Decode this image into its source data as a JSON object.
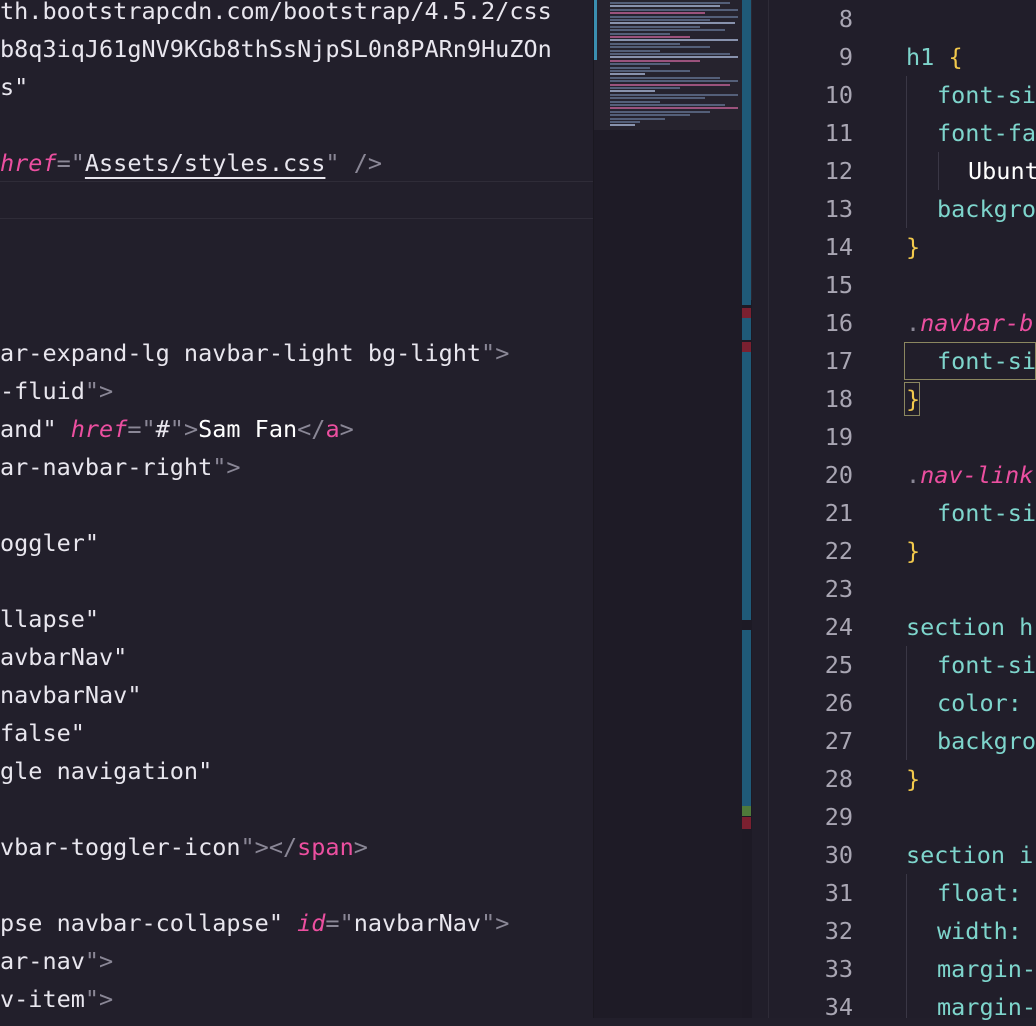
{
  "left_editor": {
    "lines": [
      {
        "parts": [
          [
            "tok-str",
            "th.bootstrapcdn.com/bootstrap/4.5.2/css"
          ]
        ]
      },
      {
        "parts": [
          [
            "tok-str",
            "b8q3iqJ61gNV9KGb8thSsNjpSL0n8PARn9HuZOn"
          ]
        ]
      },
      {
        "parts": [
          [
            "tok-str",
            "s\""
          ]
        ]
      },
      {
        "parts": []
      },
      {
        "parts": [
          [
            "tok-attr",
            "href"
          ],
          [
            "tok-punc",
            "=\""
          ],
          [
            "tok-str underline",
            "Assets/styles.css"
          ],
          [
            "tok-punc",
            "\" />"
          ]
        ]
      },
      {
        "parts": []
      },
      {
        "parts": []
      },
      {
        "parts": []
      },
      {
        "parts": []
      },
      {
        "parts": [
          [
            "tok-str",
            "ar-expand-lg navbar-light bg-light"
          ],
          [
            "tok-punc",
            "\">"
          ]
        ]
      },
      {
        "parts": [
          [
            "tok-str",
            "-fluid"
          ],
          [
            "tok-punc",
            "\">"
          ]
        ]
      },
      {
        "parts": [
          [
            "tok-str",
            "and\" "
          ],
          [
            "tok-attr",
            "href"
          ],
          [
            "tok-punc",
            "=\""
          ],
          [
            "tok-str",
            "#"
          ],
          [
            "tok-punc",
            "\">"
          ],
          [
            "tok-text",
            "Sam Fan"
          ],
          [
            "tok-punc",
            "</"
          ],
          [
            "tok-tag",
            "a"
          ],
          [
            "tok-punc",
            ">"
          ]
        ]
      },
      {
        "parts": [
          [
            "tok-str",
            "ar-navbar-right"
          ],
          [
            "tok-punc",
            "\">"
          ]
        ]
      },
      {
        "parts": []
      },
      {
        "parts": [
          [
            "tok-str",
            "oggler\""
          ]
        ]
      },
      {
        "parts": []
      },
      {
        "parts": [
          [
            "tok-str",
            "llapse\""
          ]
        ]
      },
      {
        "parts": [
          [
            "tok-str",
            "avbarNav\""
          ]
        ]
      },
      {
        "parts": [
          [
            "tok-str",
            "navbarNav\""
          ]
        ]
      },
      {
        "parts": [
          [
            "tok-str",
            "false\""
          ]
        ]
      },
      {
        "parts": [
          [
            "tok-str",
            "gle navigation\""
          ]
        ]
      },
      {
        "parts": []
      },
      {
        "parts": [
          [
            "tok-str",
            "vbar-toggler-icon"
          ],
          [
            "tok-punc",
            "\"></"
          ],
          [
            "tok-tag",
            "span"
          ],
          [
            "tok-punc",
            ">"
          ]
        ]
      },
      {
        "parts": []
      },
      {
        "parts": [
          [
            "tok-str",
            "pse navbar-collapse\" "
          ],
          [
            "tok-attr",
            "id"
          ],
          [
            "tok-punc",
            "=\""
          ],
          [
            "tok-str",
            "navbarNav"
          ],
          [
            "tok-punc",
            "\">"
          ]
        ]
      },
      {
        "parts": [
          [
            "tok-str",
            "ar-nav"
          ],
          [
            "tok-punc",
            "\">"
          ]
        ]
      },
      {
        "parts": [
          [
            "tok-str",
            "v-item"
          ],
          [
            "tok-punc",
            "\">"
          ]
        ]
      }
    ]
  },
  "right_editor": {
    "line_numbers": [
      "8",
      "9",
      "10",
      "11",
      "12",
      "13",
      "14",
      "15",
      "16",
      "17",
      "18",
      "19",
      "20",
      "21",
      "22",
      "23",
      "24",
      "25",
      "26",
      "27",
      "28",
      "29",
      "30",
      "31",
      "32",
      "33",
      "34"
    ],
    "lines": [
      {
        "indent": 0,
        "parts": []
      },
      {
        "indent": 0,
        "parts": [
          [
            "sel",
            "h1 "
          ],
          [
            "brace",
            "{"
          ]
        ]
      },
      {
        "indent": 1,
        "parts": [
          [
            "prop",
            "font-si"
          ]
        ]
      },
      {
        "indent": 1,
        "parts": [
          [
            "prop",
            "font-fa"
          ]
        ]
      },
      {
        "indent": 2,
        "parts": [
          [
            "val",
            "Ubunt"
          ]
        ]
      },
      {
        "indent": 1,
        "parts": [
          [
            "prop",
            "backgro"
          ]
        ]
      },
      {
        "indent": 0,
        "parts": [
          [
            "brace",
            "}"
          ]
        ]
      },
      {
        "indent": 0,
        "parts": []
      },
      {
        "indent": 0,
        "parts": [
          [
            "dot",
            "."
          ],
          [
            "cls",
            "navbar-b"
          ]
        ]
      },
      {
        "indent": 1,
        "parts": [
          [
            "prop",
            "font-si"
          ]
        ]
      },
      {
        "indent": 0,
        "parts": [
          [
            "brace",
            "}"
          ]
        ]
      },
      {
        "indent": 0,
        "parts": []
      },
      {
        "indent": 0,
        "parts": [
          [
            "dot",
            "."
          ],
          [
            "cls",
            "nav-link"
          ]
        ]
      },
      {
        "indent": 1,
        "parts": [
          [
            "prop",
            "font-si"
          ]
        ]
      },
      {
        "indent": 0,
        "parts": [
          [
            "brace",
            "}"
          ]
        ]
      },
      {
        "indent": 0,
        "parts": []
      },
      {
        "indent": 0,
        "parts": [
          [
            "sel",
            "section h"
          ]
        ]
      },
      {
        "indent": 1,
        "parts": [
          [
            "prop",
            "font-si"
          ]
        ]
      },
      {
        "indent": 1,
        "parts": [
          [
            "prop",
            "color: "
          ]
        ]
      },
      {
        "indent": 1,
        "parts": [
          [
            "prop",
            "backgro"
          ]
        ]
      },
      {
        "indent": 0,
        "parts": [
          [
            "brace",
            "}"
          ]
        ]
      },
      {
        "indent": 0,
        "parts": []
      },
      {
        "indent": 0,
        "parts": [
          [
            "sel",
            "section i"
          ]
        ]
      },
      {
        "indent": 1,
        "parts": [
          [
            "prop",
            "float: "
          ]
        ]
      },
      {
        "indent": 1,
        "parts": [
          [
            "prop",
            "width: "
          ]
        ]
      },
      {
        "indent": 1,
        "parts": [
          [
            "prop",
            "margin-"
          ]
        ]
      },
      {
        "indent": 1,
        "parts": [
          [
            "prop",
            "margin-"
          ]
        ]
      }
    ]
  }
}
